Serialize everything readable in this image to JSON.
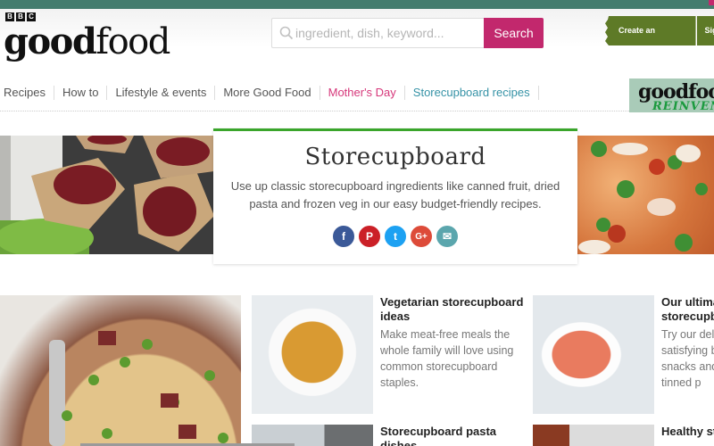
{
  "brand": {
    "bbc_letters": [
      "B",
      "B",
      "C"
    ],
    "logo_bold": "good",
    "logo_light": "food"
  },
  "search": {
    "placeholder": "ingredient, dish, keyword...",
    "button_label": "Search"
  },
  "account": {
    "create_label": "Create an account",
    "signin_label": "Sign in"
  },
  "nav": {
    "items": [
      {
        "label": "Recipes"
      },
      {
        "label": "How to"
      },
      {
        "label": "Lifestyle & events"
      },
      {
        "label": "More Good Food"
      },
      {
        "label": "Mother's Day"
      },
      {
        "label": "Storecupboard recipes"
      }
    ]
  },
  "magazine_promo": {
    "masthead": "goodfood",
    "tagline": "REINVENT"
  },
  "hero": {
    "title": "Storecupboard",
    "description": "Use up classic storecupboard ingredients like canned fruit, dried pasta and frozen veg in our easy budget-friendly recipes.",
    "share": [
      {
        "icon": "facebook-icon",
        "glyph": "f",
        "color": "#3b5998"
      },
      {
        "icon": "pinterest-icon",
        "glyph": "P",
        "color": "#cb2027"
      },
      {
        "icon": "twitter-icon",
        "glyph": "t",
        "color": "#1da1f2"
      },
      {
        "icon": "google-plus-icon",
        "glyph": "G+",
        "color": "#dd4b39"
      },
      {
        "icon": "email-icon",
        "glyph": "✉",
        "color": "#5ba6ad"
      }
    ]
  },
  "collections": [
    {
      "title": "Vegetarian storecupboard ideas",
      "description": "Make meat-free meals the whole family will love using common storecupboard staples."
    },
    {
      "title": "Storecupboard pasta dishes",
      "description": ""
    },
    {
      "title": "Our ultimate storecupboard",
      "description": "Try our delicious, satisfying bakes, snacks and dishes of tinned p"
    },
    {
      "title": "Healthy storecupboard meals",
      "description": ""
    }
  ],
  "colors": {
    "topbar": "#447c6e",
    "search_button": "#c2286d",
    "account_button": "#5e7a27",
    "accent_green": "#3aa52b",
    "nav_pink": "#d6377a",
    "nav_teal": "#3592a6"
  }
}
